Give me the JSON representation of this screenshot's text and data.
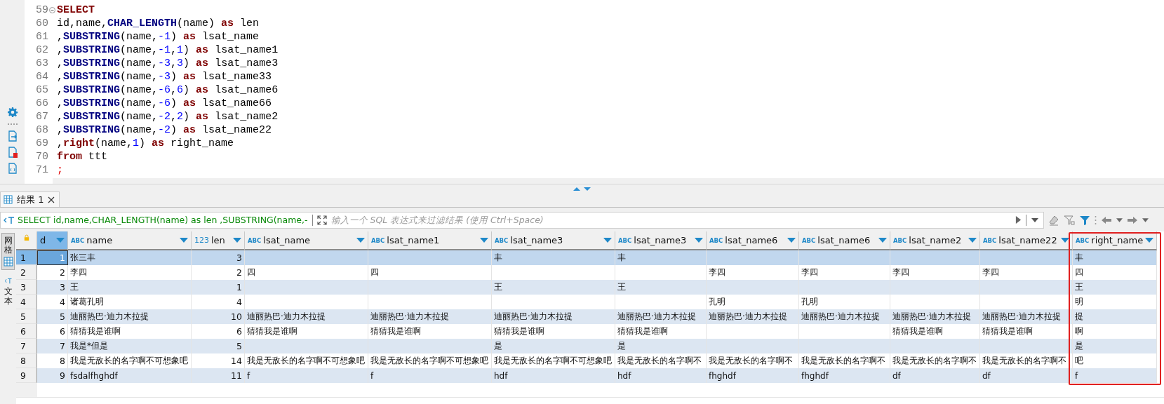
{
  "editor": {
    "lines": [
      {
        "number": "59",
        "tokens": [
          {
            "text": "SELECT",
            "kind": "keyword"
          }
        ]
      },
      {
        "number": "60",
        "tokens": [
          {
            "text": "id,name,",
            "kind": "text"
          },
          {
            "text": "CHAR_LENGTH",
            "kind": "function"
          },
          {
            "text": "(name) ",
            "kind": "text"
          },
          {
            "text": "as",
            "kind": "keyword"
          },
          {
            "text": " len",
            "kind": "text"
          }
        ]
      },
      {
        "number": "61",
        "tokens": [
          {
            "text": ",",
            "kind": "text"
          },
          {
            "text": "SUBSTRING",
            "kind": "function"
          },
          {
            "text": "(name,",
            "kind": "text"
          },
          {
            "text": "-1",
            "kind": "number"
          },
          {
            "text": ") ",
            "kind": "text"
          },
          {
            "text": "as",
            "kind": "keyword"
          },
          {
            "text": " lsat_name",
            "kind": "text"
          }
        ]
      },
      {
        "number": "62",
        "tokens": [
          {
            "text": ",",
            "kind": "text"
          },
          {
            "text": "SUBSTRING",
            "kind": "function"
          },
          {
            "text": "(name,",
            "kind": "text"
          },
          {
            "text": "-1",
            "kind": "number"
          },
          {
            "text": ",",
            "kind": "text"
          },
          {
            "text": "1",
            "kind": "number"
          },
          {
            "text": ") ",
            "kind": "text"
          },
          {
            "text": "as",
            "kind": "keyword"
          },
          {
            "text": " lsat_name1",
            "kind": "text"
          }
        ]
      },
      {
        "number": "63",
        "tokens": [
          {
            "text": ",",
            "kind": "text"
          },
          {
            "text": "SUBSTRING",
            "kind": "function"
          },
          {
            "text": "(name,",
            "kind": "text"
          },
          {
            "text": "-3",
            "kind": "number"
          },
          {
            "text": ",",
            "kind": "text"
          },
          {
            "text": "3",
            "kind": "number"
          },
          {
            "text": ") ",
            "kind": "text"
          },
          {
            "text": "as",
            "kind": "keyword"
          },
          {
            "text": " lsat_name3",
            "kind": "text"
          }
        ]
      },
      {
        "number": "64",
        "tokens": [
          {
            "text": ",",
            "kind": "text"
          },
          {
            "text": "SUBSTRING",
            "kind": "function"
          },
          {
            "text": "(name,",
            "kind": "text"
          },
          {
            "text": "-3",
            "kind": "number"
          },
          {
            "text": ") ",
            "kind": "text"
          },
          {
            "text": "as",
            "kind": "keyword"
          },
          {
            "text": " lsat_name33",
            "kind": "text"
          }
        ]
      },
      {
        "number": "65",
        "tokens": [
          {
            "text": ",",
            "kind": "text"
          },
          {
            "text": "SUBSTRING",
            "kind": "function"
          },
          {
            "text": "(name,",
            "kind": "text"
          },
          {
            "text": "-6",
            "kind": "number"
          },
          {
            "text": ",",
            "kind": "text"
          },
          {
            "text": "6",
            "kind": "number"
          },
          {
            "text": ") ",
            "kind": "text"
          },
          {
            "text": "as",
            "kind": "keyword"
          },
          {
            "text": " lsat_name6",
            "kind": "text"
          }
        ]
      },
      {
        "number": "66",
        "tokens": [
          {
            "text": ",",
            "kind": "text"
          },
          {
            "text": "SUBSTRING",
            "kind": "function"
          },
          {
            "text": "(name,",
            "kind": "text"
          },
          {
            "text": "-6",
            "kind": "number"
          },
          {
            "text": ") ",
            "kind": "text"
          },
          {
            "text": "as",
            "kind": "keyword"
          },
          {
            "text": " lsat_name66",
            "kind": "text"
          }
        ]
      },
      {
        "number": "67",
        "tokens": [
          {
            "text": ",",
            "kind": "text"
          },
          {
            "text": "SUBSTRING",
            "kind": "function"
          },
          {
            "text": "(name,",
            "kind": "text"
          },
          {
            "text": "-2",
            "kind": "number"
          },
          {
            "text": ",",
            "kind": "text"
          },
          {
            "text": "2",
            "kind": "number"
          },
          {
            "text": ") ",
            "kind": "text"
          },
          {
            "text": "as",
            "kind": "keyword"
          },
          {
            "text": " lsat_name2",
            "kind": "text"
          }
        ]
      },
      {
        "number": "68",
        "tokens": [
          {
            "text": ",",
            "kind": "text"
          },
          {
            "text": "SUBSTRING",
            "kind": "function"
          },
          {
            "text": "(name,",
            "kind": "text"
          },
          {
            "text": "-2",
            "kind": "number"
          },
          {
            "text": ") ",
            "kind": "text"
          },
          {
            "text": "as",
            "kind": "keyword"
          },
          {
            "text": " lsat_name22",
            "kind": "text"
          }
        ]
      },
      {
        "number": "69",
        "tokens": [
          {
            "text": ",",
            "kind": "text"
          },
          {
            "text": "right",
            "kind": "keyword"
          },
          {
            "text": "(name,",
            "kind": "text"
          },
          {
            "text": "1",
            "kind": "number"
          },
          {
            "text": ") ",
            "kind": "text"
          },
          {
            "text": "as",
            "kind": "keyword"
          },
          {
            "text": " right_name",
            "kind": "text"
          }
        ]
      },
      {
        "number": "70",
        "tokens": [
          {
            "text": "from",
            "kind": "keyword"
          },
          {
            "text": " ttt",
            "kind": "text"
          }
        ]
      },
      {
        "number": "71",
        "tokens": [
          {
            "text": ";",
            "kind": "terminator"
          }
        ]
      }
    ]
  },
  "result_tab": {
    "label": "结果 1"
  },
  "filter": {
    "query": "SELECT id,name,CHAR_LENGTH(name) as len ,SUBSTRING(name,-",
    "placeholder": "输入一个 SQL 表达式来过滤结果 (使用 Ctrl+Space)"
  },
  "view_tabs": [
    {
      "label": "网格",
      "kind": "grid",
      "selected": true
    },
    {
      "label": "文本",
      "kind": "text",
      "selected": false
    }
  ],
  "table": {
    "columns": [
      {
        "label": "d",
        "kind": "number",
        "selected": true,
        "highlighted": false
      },
      {
        "label": "name",
        "type_label": "ABC",
        "kind": "text",
        "selected": false,
        "highlighted": false
      },
      {
        "label": "len",
        "type_label": "123",
        "kind": "number",
        "selected": false,
        "highlighted": false
      },
      {
        "label": "lsat_name",
        "type_label": "ABC",
        "kind": "text",
        "selected": false,
        "highlighted": false
      },
      {
        "label": "lsat_name1",
        "type_label": "ABC",
        "kind": "text",
        "selected": false,
        "highlighted": false
      },
      {
        "label": "lsat_name3",
        "type_label": "ABC",
        "kind": "text",
        "selected": false,
        "highlighted": false
      },
      {
        "label": "lsat_name3",
        "type_label": "ABC",
        "kind": "text",
        "selected": false,
        "highlighted": false
      },
      {
        "label": "lsat_name6",
        "type_label": "ABC",
        "kind": "text",
        "selected": false,
        "highlighted": false
      },
      {
        "label": "lsat_name6",
        "type_label": "ABC",
        "kind": "text",
        "selected": false,
        "highlighted": false
      },
      {
        "label": "lsat_name2",
        "type_label": "ABC",
        "kind": "text",
        "selected": false,
        "highlighted": false
      },
      {
        "label": "lsat_name22",
        "type_label": "ABC",
        "kind": "text",
        "selected": false,
        "highlighted": false
      },
      {
        "label": "right_name",
        "type_label": "ABC",
        "kind": "text",
        "selected": false,
        "highlighted": true
      }
    ],
    "rows": [
      {
        "number": "1",
        "selected": true,
        "cells": [
          "1",
          "张三丰",
          "3",
          "",
          "",
          "丰",
          "丰",
          "",
          "",
          "",
          "",
          "丰"
        ]
      },
      {
        "number": "2",
        "selected": false,
        "cells": [
          "2",
          "李四",
          "2",
          "四",
          "四",
          "",
          "",
          "李四",
          "李四",
          "李四",
          "李四",
          "四"
        ]
      },
      {
        "number": "3",
        "selected": false,
        "cells": [
          "3",
          "王",
          "1",
          "",
          "",
          "王",
          "王",
          "",
          "",
          "",
          "",
          "王"
        ]
      },
      {
        "number": "4",
        "selected": false,
        "cells": [
          "4",
          "诸葛孔明",
          "4",
          "",
          "",
          "",
          "",
          "孔明",
          "孔明",
          "",
          "",
          "明"
        ]
      },
      {
        "number": "5",
        "selected": false,
        "cells": [
          "5",
          "迪丽热巴·迪力木拉提",
          "10",
          "迪丽热巴·迪力木拉提",
          "迪丽热巴·迪力木拉提",
          "迪丽热巴·迪力木拉提",
          "迪丽热巴·迪力木拉提",
          "迪丽热巴·迪力木拉提",
          "迪丽热巴·迪力木拉提",
          "迪丽热巴·迪力木拉提",
          "迪丽热巴·迪力木拉提",
          "提"
        ]
      },
      {
        "number": "6",
        "selected": false,
        "cells": [
          "6",
          "猜猜我是谁啊",
          "6",
          "猜猜我是谁啊",
          "猜猜我是谁啊",
          "猜猜我是谁啊",
          "猜猜我是谁啊",
          "",
          "",
          "猜猜我是谁啊",
          "猜猜我是谁啊",
          "啊"
        ]
      },
      {
        "number": "7",
        "selected": false,
        "cells": [
          "7",
          "我是*但是",
          "5",
          "",
          "",
          "是",
          "是",
          "",
          "",
          "",
          "",
          "是"
        ]
      },
      {
        "number": "8",
        "selected": false,
        "cells": [
          "8",
          "我是无敌长的名字啊不可想象吧",
          "14",
          "我是无敌长的名字啊不可想象吧",
          "我是无敌长的名字啊不可想象吧",
          "我是无敌长的名字啊不可想象吧",
          "我是无敌长的名字啊不",
          "我是无敌长的名字啊不",
          "我是无敌长的名字啊不",
          "我是无敌长的名字啊不",
          "我是无敌长的名字啊不",
          "吧"
        ]
      },
      {
        "number": "9",
        "selected": false,
        "cells": [
          "9",
          "fsdalfhghdf",
          "11",
          "f",
          "f",
          "hdf",
          "hdf",
          "fhghdf",
          "fhghdf",
          "df",
          "df",
          "f"
        ]
      }
    ]
  }
}
